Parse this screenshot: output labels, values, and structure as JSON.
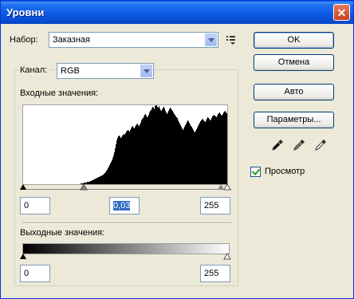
{
  "window": {
    "title": "Уровни",
    "close_glyph": "✕"
  },
  "preset": {
    "label": "Набор:",
    "value": "Заказная",
    "menu_icon": "preset-options-icon"
  },
  "channel": {
    "label": "Канал:",
    "value": "RGB"
  },
  "input_levels": {
    "label": "Входные значения:",
    "black": "0",
    "gamma": "0,03",
    "white": "255"
  },
  "output_levels": {
    "label": "Выходные значения:",
    "black": "0",
    "white": "255"
  },
  "buttons": {
    "ok": "OK",
    "cancel": "Отмена",
    "auto": "Авто",
    "options": "Параметры..."
  },
  "preview": {
    "label": "Просмотр",
    "checked": true
  },
  "eyedroppers": [
    "black-eyedropper-icon",
    "gray-eyedropper-icon",
    "white-eyedropper-icon"
  ],
  "histogram": {
    "values": [
      0,
      0,
      0,
      0,
      0,
      0,
      0,
      0,
      0,
      0,
      0,
      0,
      0,
      0,
      0,
      0,
      0,
      0,
      0,
      0,
      0,
      0,
      0,
      0,
      0,
      0,
      0,
      0,
      0,
      0,
      0,
      0,
      0,
      0,
      0,
      0,
      0,
      0,
      0,
      0,
      0,
      0,
      0,
      0,
      0,
      0,
      0,
      0,
      0,
      0,
      0,
      0,
      0,
      0,
      0,
      0,
      0,
      0,
      0,
      0,
      0,
      0,
      0,
      0,
      0,
      0,
      0,
      0,
      0,
      0,
      0,
      0,
      1,
      1,
      1,
      1,
      2,
      2,
      2,
      2,
      3,
      3,
      3,
      3,
      4,
      4,
      5,
      5,
      6,
      6,
      7,
      7,
      8,
      8,
      9,
      9,
      10,
      10,
      11,
      11,
      12,
      13,
      14,
      15,
      17,
      18,
      20,
      22,
      24,
      26,
      28,
      30,
      33,
      36,
      40,
      45,
      50,
      55,
      58,
      60,
      61,
      60,
      58,
      59,
      61,
      62,
      63,
      62,
      64,
      66,
      67,
      68,
      67,
      66,
      68,
      70,
      72,
      73,
      71,
      70,
      72,
      74,
      75,
      76,
      74,
      73,
      75,
      77,
      80,
      82,
      83,
      85,
      87,
      88,
      86,
      84,
      85,
      87,
      90,
      92,
      93,
      95,
      97,
      96,
      94,
      98,
      100,
      99,
      97,
      96,
      98,
      95,
      93,
      92,
      94,
      96,
      97,
      95,
      92,
      90,
      88,
      90,
      92,
      94,
      96,
      95,
      93,
      92,
      90,
      88,
      87,
      85,
      84,
      83,
      80,
      78,
      76,
      74,
      72,
      70,
      68,
      70,
      72,
      74,
      76,
      78,
      80,
      79,
      77,
      75,
      73,
      72,
      70,
      68,
      66,
      65,
      67,
      69,
      71,
      73,
      75,
      77,
      79,
      80,
      81,
      82,
      80,
      79,
      78,
      80,
      82,
      84,
      83,
      82,
      80,
      81,
      83,
      85,
      86,
      87,
      86,
      85,
      84,
      86,
      88,
      89,
      90,
      88,
      87,
      86,
      88,
      90,
      91,
      92,
      90,
      89,
      88,
      90
    ]
  }
}
